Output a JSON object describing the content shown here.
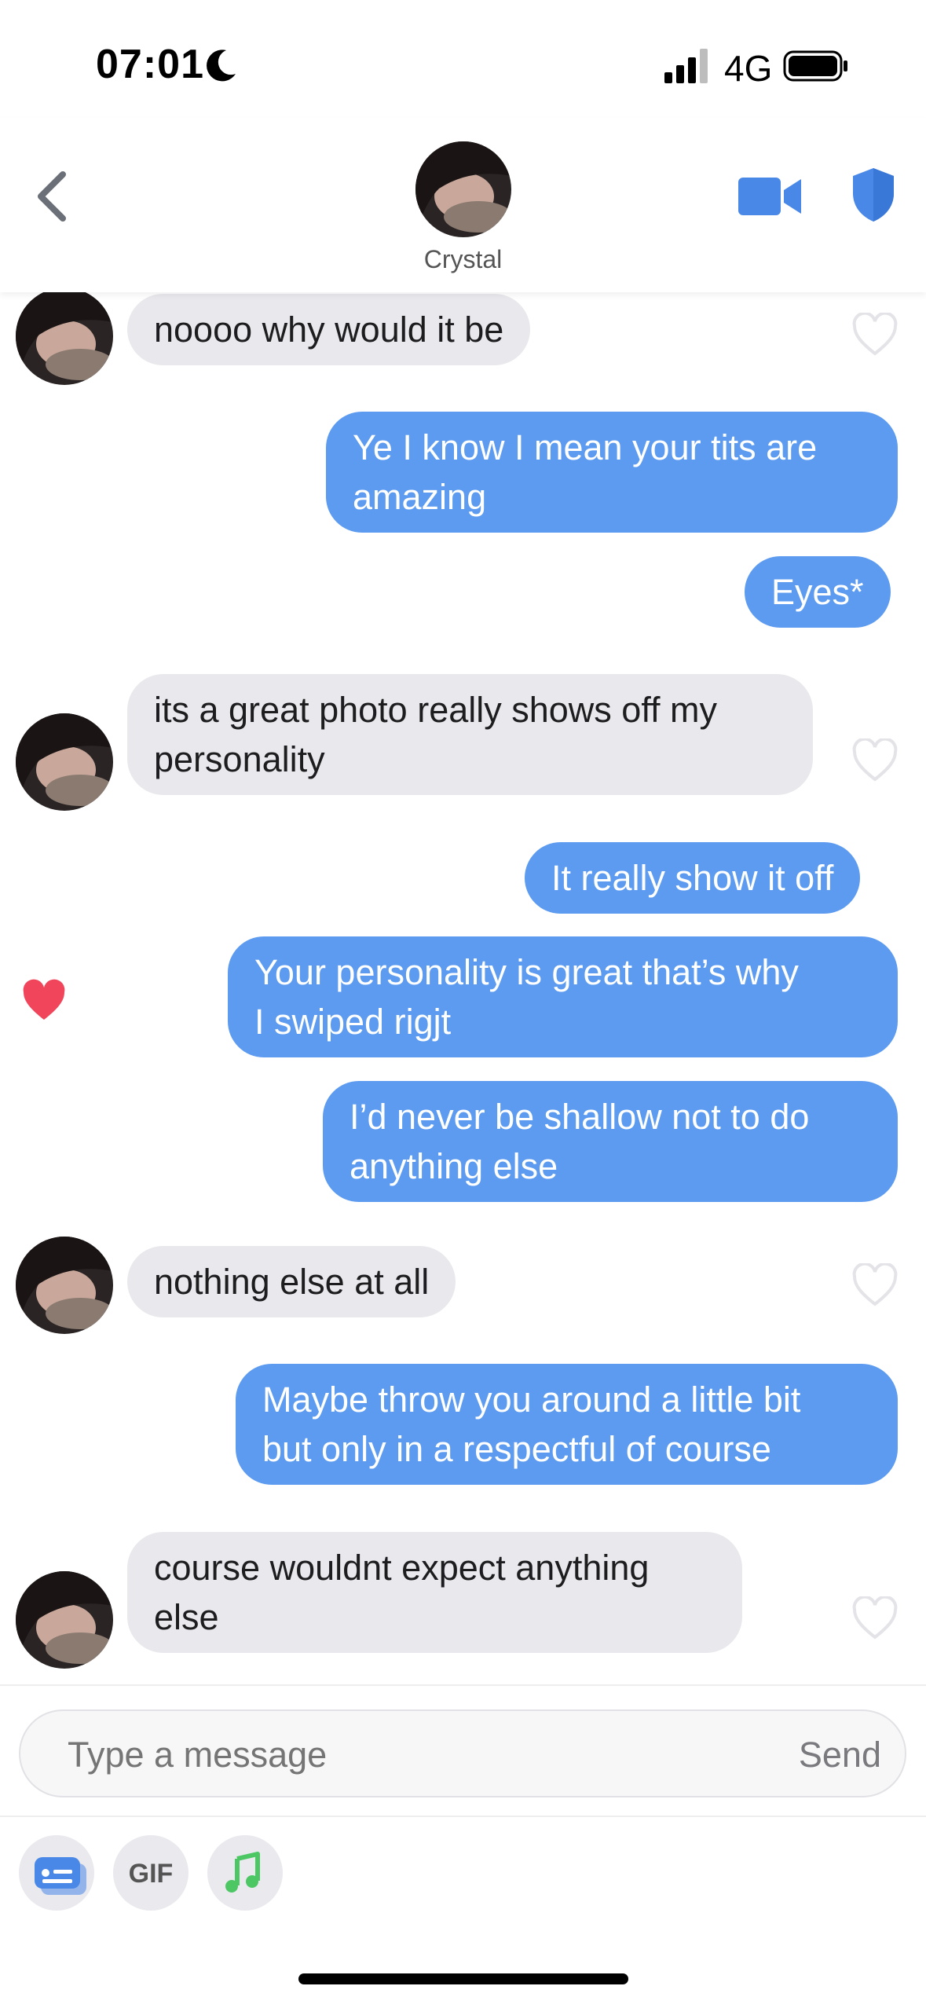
{
  "status_bar": {
    "time": "07:01",
    "network": "4G"
  },
  "header": {
    "contact_name": "Crystal"
  },
  "messages": [
    {
      "from": "them",
      "text_lines": [
        "noooo why would it be"
      ]
    },
    {
      "from": "me",
      "text_lines": [
        "Ye I know I mean your tits are",
        "amazing"
      ]
    },
    {
      "from": "me",
      "text_lines": [
        "Eyes*"
      ]
    },
    {
      "from": "them",
      "text_lines": [
        "its a great photo really shows off my",
        "personality"
      ]
    },
    {
      "from": "me",
      "text_lines": [
        "It really show it off"
      ]
    },
    {
      "from": "me",
      "text_lines": [
        "Your personality is great that’s why",
        "I swiped rigjt"
      ],
      "liked": true
    },
    {
      "from": "me",
      "text_lines": [
        "I’d never be shallow not to do",
        "anything else"
      ]
    },
    {
      "from": "them",
      "text_lines": [
        "nothing else at all"
      ]
    },
    {
      "from": "me",
      "text_lines": [
        "Maybe throw you around a little bit",
        "but only in a respectful of course"
      ]
    },
    {
      "from": "them",
      "text_lines": [
        "course wouldnt expect anything",
        "else"
      ]
    }
  ],
  "composer": {
    "placeholder": "Type a message",
    "send_label": "Send"
  },
  "tools": {
    "gif_label": "GIF"
  },
  "colors": {
    "outgoing": "#5c9bf0",
    "incoming": "#e9e9ed",
    "accent": "#4a88e8",
    "heart": "#f0455a"
  },
  "icons": [
    "moon-icon",
    "signal-icon",
    "battery-icon",
    "back-chevron-icon",
    "video-call-icon",
    "shield-icon",
    "heart-outline-icon",
    "heart-filled-icon",
    "id-card-icon",
    "music-note-icon"
  ]
}
